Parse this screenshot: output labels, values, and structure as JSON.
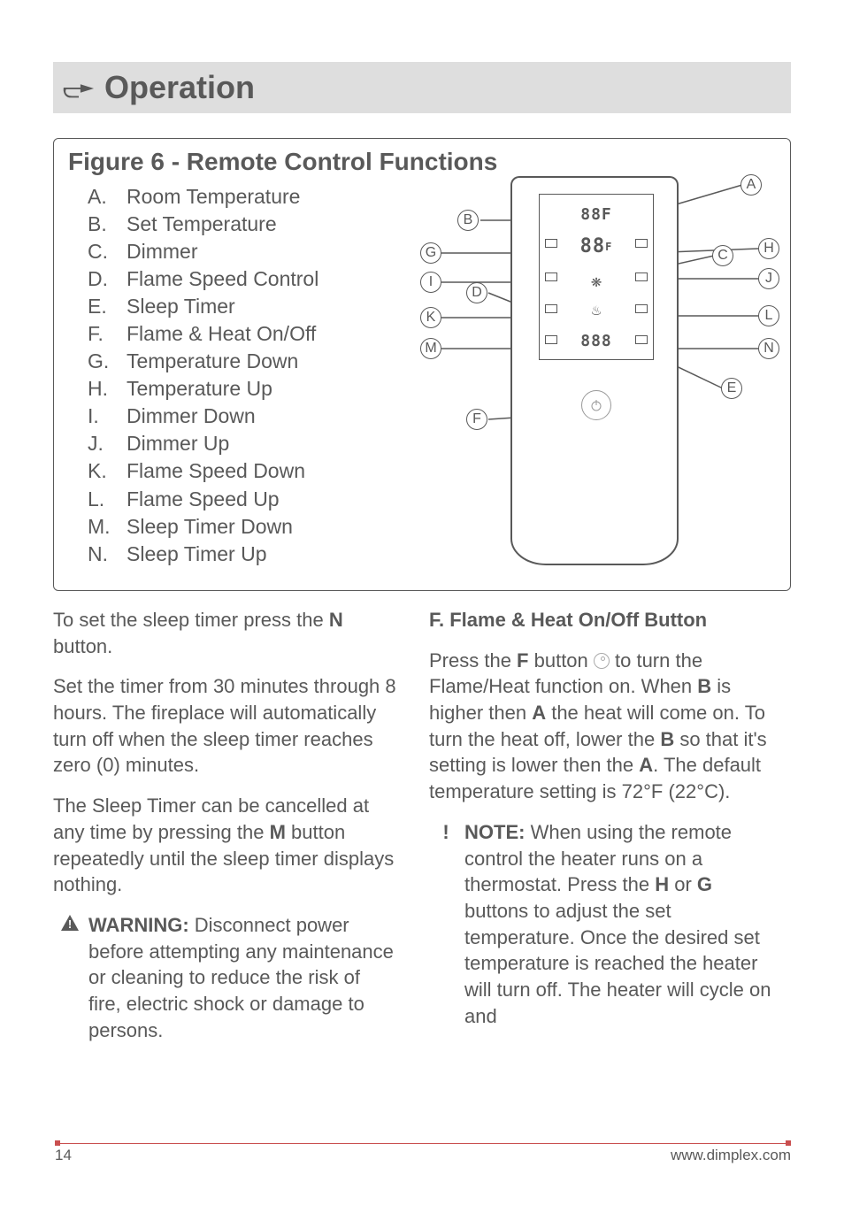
{
  "header": {
    "title": "Operation"
  },
  "figure": {
    "title": "Figure 6 - Remote Control Functions",
    "items": [
      {
        "letter": "A.",
        "label": "Room Temperature"
      },
      {
        "letter": "B.",
        "label": "Set Temperature"
      },
      {
        "letter": "C.",
        "label": "Dimmer"
      },
      {
        "letter": "D.",
        "label": "Flame Speed Control"
      },
      {
        "letter": "E.",
        "label": "Sleep Timer"
      },
      {
        "letter": "F.",
        "label": "Flame & Heat On/Off"
      },
      {
        "letter": "G.",
        "label": "Temperature Down"
      },
      {
        "letter": "H.",
        "label": "Temperature Up"
      },
      {
        "letter": "I.",
        "label": "Dimmer Down"
      },
      {
        "letter": "J.",
        "label": "Dimmer Up"
      },
      {
        "letter": "K.",
        "label": "Flame Speed Down"
      },
      {
        "letter": "L.",
        "label": "Flame Speed Up"
      },
      {
        "letter": "M.",
        "label": "Sleep Timer Down"
      },
      {
        "letter": "N.",
        "label": "Sleep Timer Up"
      }
    ],
    "callouts": [
      "A",
      "B",
      "C",
      "D",
      "E",
      "F",
      "G",
      "H",
      "I",
      "J",
      "K",
      "L",
      "M",
      "N"
    ]
  },
  "left_col": {
    "p1_a": "To set the sleep timer press the ",
    "p1_b": "N",
    "p1_c": " button.",
    "p2": "Set the timer from 30 minutes through 8 hours.  The fireplace will automatically turn off when the sleep timer reaches zero (0) minutes.",
    "p3_a": "The Sleep Timer can be cancelled at any time by pressing the ",
    "p3_b": "M",
    "p3_c": " button repeatedly until the sleep timer displays nothing.",
    "warn_label": "WARNING:",
    "warn_body": "  Disconnect power before attempting any maintenance or cleaning to reduce the risk of fire, electric shock or damage to persons."
  },
  "right_col": {
    "heading": "F.   Flame & Heat On/Off Button",
    "p1_a": "Press the ",
    "p1_b": "F",
    "p1_c": " button ",
    "p1_d": " to turn the Flame/Heat function on.  When ",
    "p1_e": "B",
    "p1_f": " is higher then ",
    "p1_g": "A",
    "p1_h": " the heat will come on.  To turn the heat off, lower the ",
    "p1_i": "B",
    "p1_j": " so that it's setting is lower then the ",
    "p1_k": "A",
    "p1_l": ".  The default temperature setting is 72°F (22°C).",
    "note_label": "NOTE:",
    "note_a": "  When using the remote control the heater runs on a thermostat. Press the ",
    "note_b": "H",
    "note_c": "  or ",
    "note_d": "G",
    "note_e": " buttons to adjust the set temperature.  Once the desired set temperature is reached the heater will turn off.  The heater will cycle on and"
  },
  "footer": {
    "page": "14",
    "url": "www.dimplex.com"
  }
}
